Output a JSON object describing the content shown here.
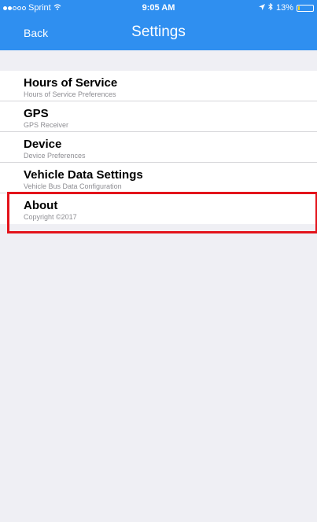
{
  "status_bar": {
    "carrier": "Sprint",
    "time": "9:05 AM",
    "battery": "13%",
    "battery_level": 0.13,
    "signal_bars_on": 2,
    "signal_bars_total": 5
  },
  "nav": {
    "back_label": "Back",
    "title": "Settings"
  },
  "items": [
    {
      "title": "Hours of Service",
      "subtitle": "Hours of Service Preferences"
    },
    {
      "title": "GPS",
      "subtitle": "GPS Receiver"
    },
    {
      "title": "Device",
      "subtitle": "Device Preferences"
    },
    {
      "title": "Vehicle Data Settings",
      "subtitle": "Vehicle Bus Data Configuration"
    },
    {
      "title": "About",
      "subtitle": "Copyright ©2017"
    }
  ],
  "highlighted_item_index": 4,
  "colors": {
    "accent": "#2f8ff0",
    "highlight": "#e3131b",
    "background": "#efeff4"
  }
}
